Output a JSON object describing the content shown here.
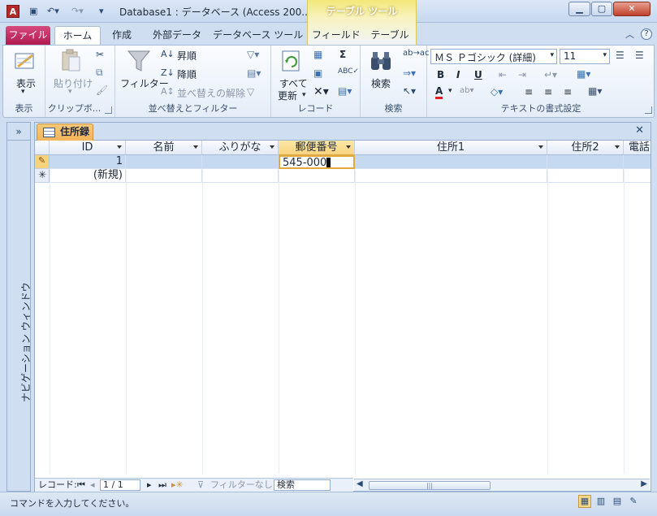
{
  "window": {
    "title": "Database1 : データベース (Access 200...",
    "tool_context": "テーブル ツール"
  },
  "tabs": [
    {
      "label": "ファイル"
    },
    {
      "label": "ホーム"
    },
    {
      "label": "作成"
    },
    {
      "label": "外部データ"
    },
    {
      "label": "データベース ツール"
    },
    {
      "label": "フィールド"
    },
    {
      "label": "テーブル"
    }
  ],
  "ribbon": {
    "view": {
      "button": "表示",
      "group": "表示"
    },
    "clipboard": {
      "paste": "貼り付け",
      "group": "クリップボ..."
    },
    "sort_filter": {
      "filter": "フィルター",
      "ascending": "昇順",
      "descending": "降順",
      "clear_sort": "並べ替えの解除",
      "group": "並べ替えとフィルター"
    },
    "records": {
      "refresh_line1": "すべて",
      "refresh_line2": "更新",
      "group": "レコード"
    },
    "find": {
      "search": "検索",
      "group": "検索"
    },
    "text_format": {
      "font_name": "ＭＳ Ｐゴシック (詳細)",
      "font_size": "11",
      "group": "テキストの書式設定"
    }
  },
  "nav_pane": {
    "label": "ナビゲーション ウィンドウ"
  },
  "document": {
    "tab_label": "住所録",
    "columns": [
      "ID",
      "名前",
      "ふりがな",
      "郵便番号",
      "住所1",
      "住所2",
      "電話"
    ],
    "rows": [
      {
        "id": "1",
        "name": "",
        "furigana": "",
        "postal": "545-000",
        "addr1": "",
        "addr2": ""
      }
    ],
    "new_row_label": "(新規)"
  },
  "record_nav": {
    "label": "レコード:",
    "position": "1 / 1",
    "filter_status": "フィルターなし",
    "search_placeholder": "検索"
  },
  "status": {
    "text": "コマンドを入力してください。"
  }
}
